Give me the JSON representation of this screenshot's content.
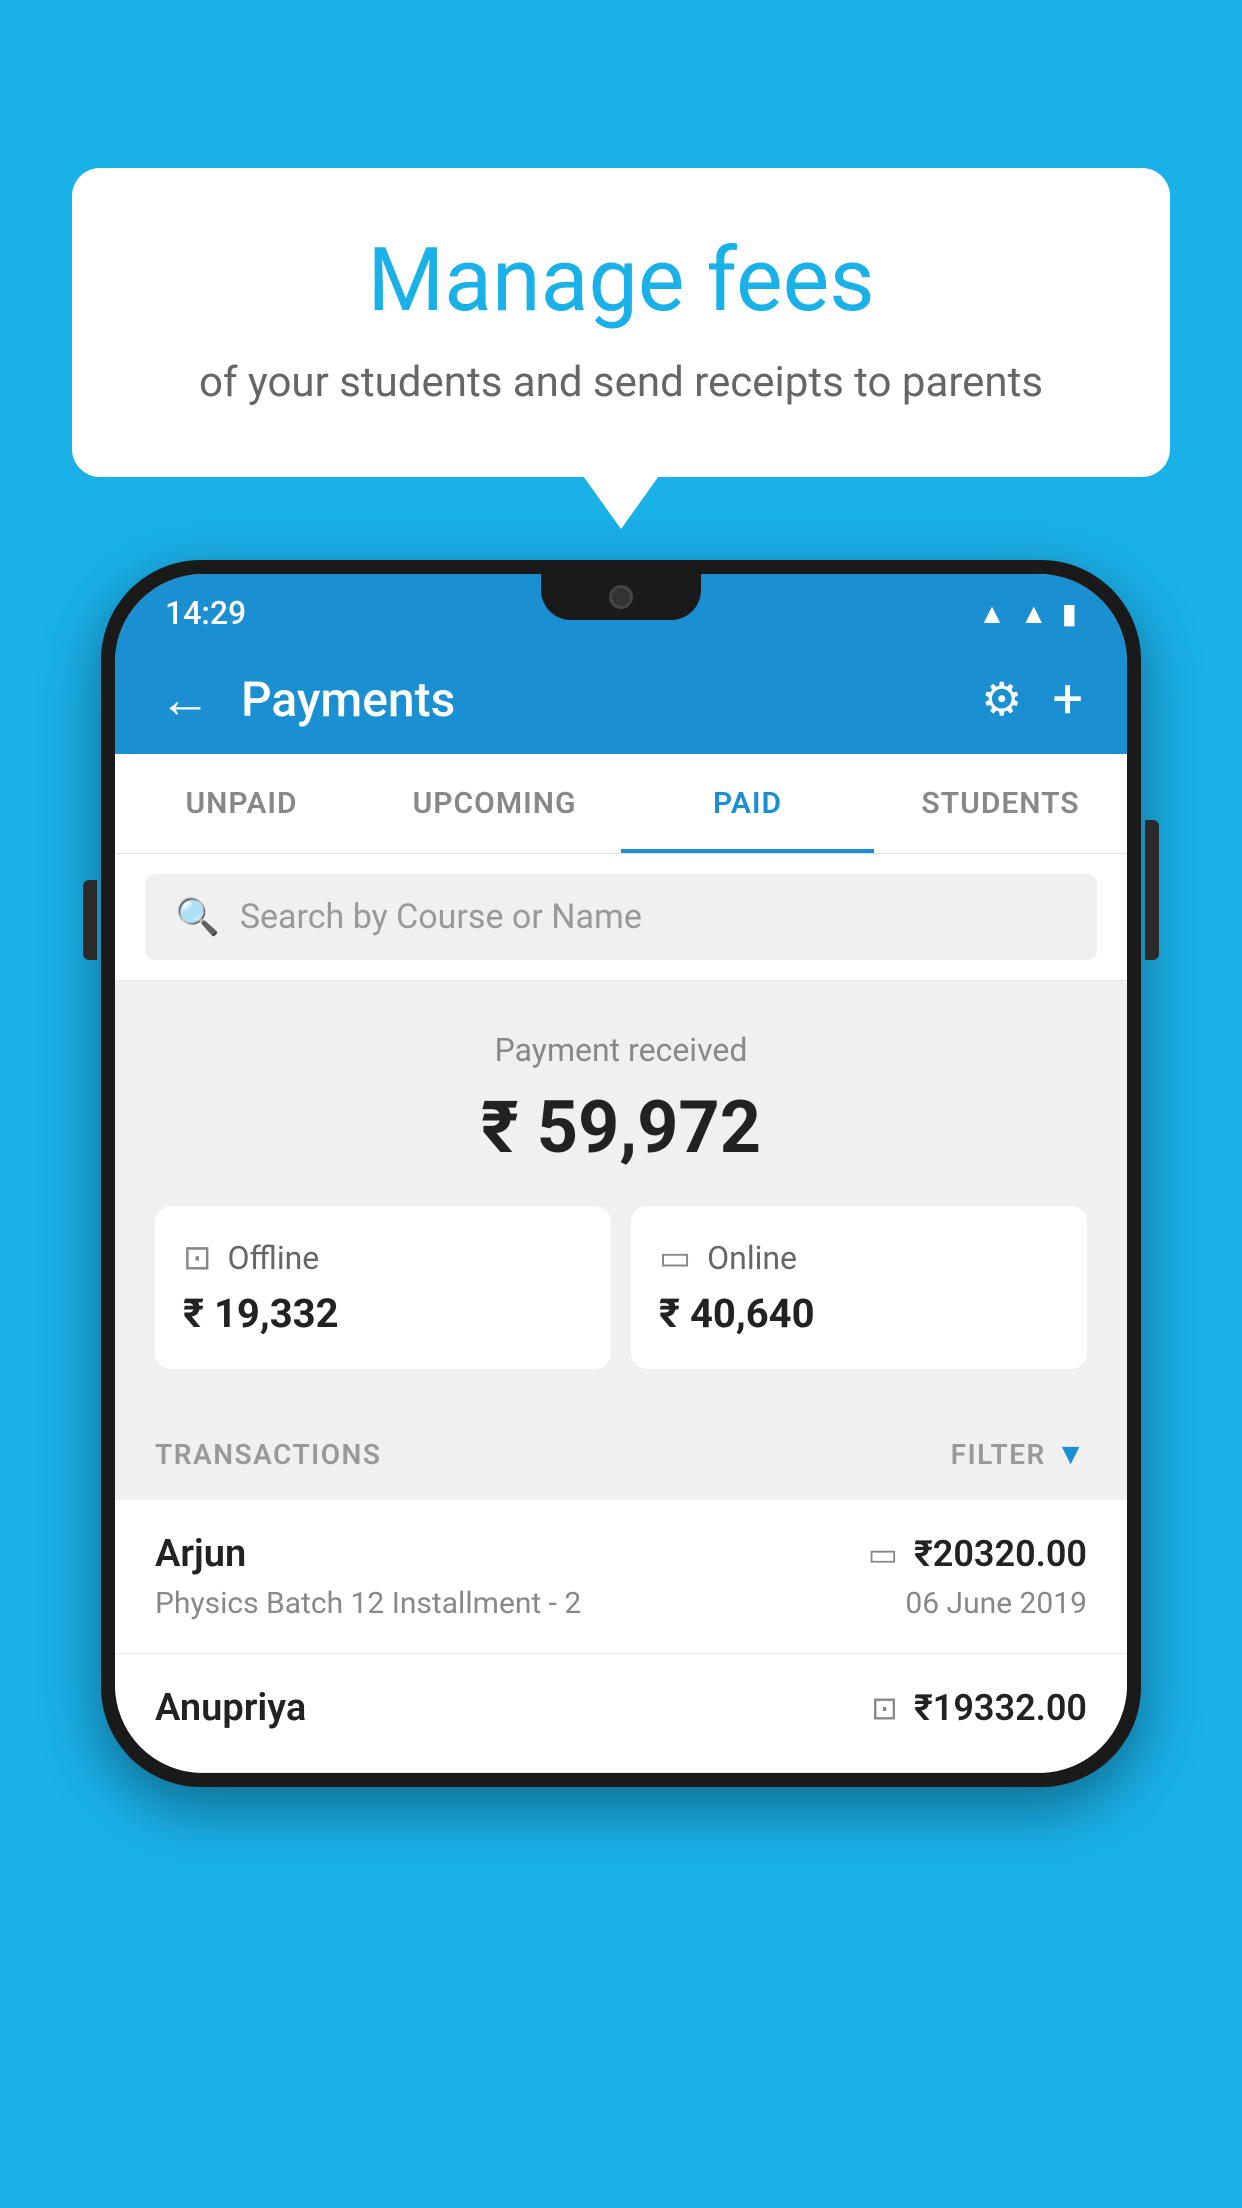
{
  "background": {
    "color": "#1ab0e8"
  },
  "speech_bubble": {
    "title": "Manage fees",
    "subtitle": "of your students and send receipts to parents"
  },
  "status_bar": {
    "time": "14:29",
    "icons": {
      "wifi": "▲",
      "signal": "▲",
      "battery": "▮"
    }
  },
  "app_header": {
    "title": "Payments",
    "back_label": "←",
    "gear_label": "⚙",
    "plus_label": "+"
  },
  "tabs": [
    {
      "id": "unpaid",
      "label": "UNPAID",
      "active": false
    },
    {
      "id": "upcoming",
      "label": "UPCOMING",
      "active": false
    },
    {
      "id": "paid",
      "label": "PAID",
      "active": true
    },
    {
      "id": "students",
      "label": "STUDENTS",
      "active": false
    }
  ],
  "search": {
    "placeholder": "Search by Course or Name"
  },
  "payment_summary": {
    "received_label": "Payment received",
    "total_amount": "₹ 59,972",
    "offline": {
      "label": "Offline",
      "amount": "₹ 19,332"
    },
    "online": {
      "label": "Online",
      "amount": "₹ 40,640"
    }
  },
  "transactions": {
    "header_label": "TRANSACTIONS",
    "filter_label": "FILTER",
    "rows": [
      {
        "name": "Arjun",
        "course": "Physics Batch 12 Installment - 2",
        "amount": "₹20320.00",
        "date": "06 June 2019",
        "payment_type": "online"
      },
      {
        "name": "Anupriya",
        "course": "",
        "amount": "₹19332.00",
        "date": "",
        "payment_type": "offline"
      }
    ]
  }
}
